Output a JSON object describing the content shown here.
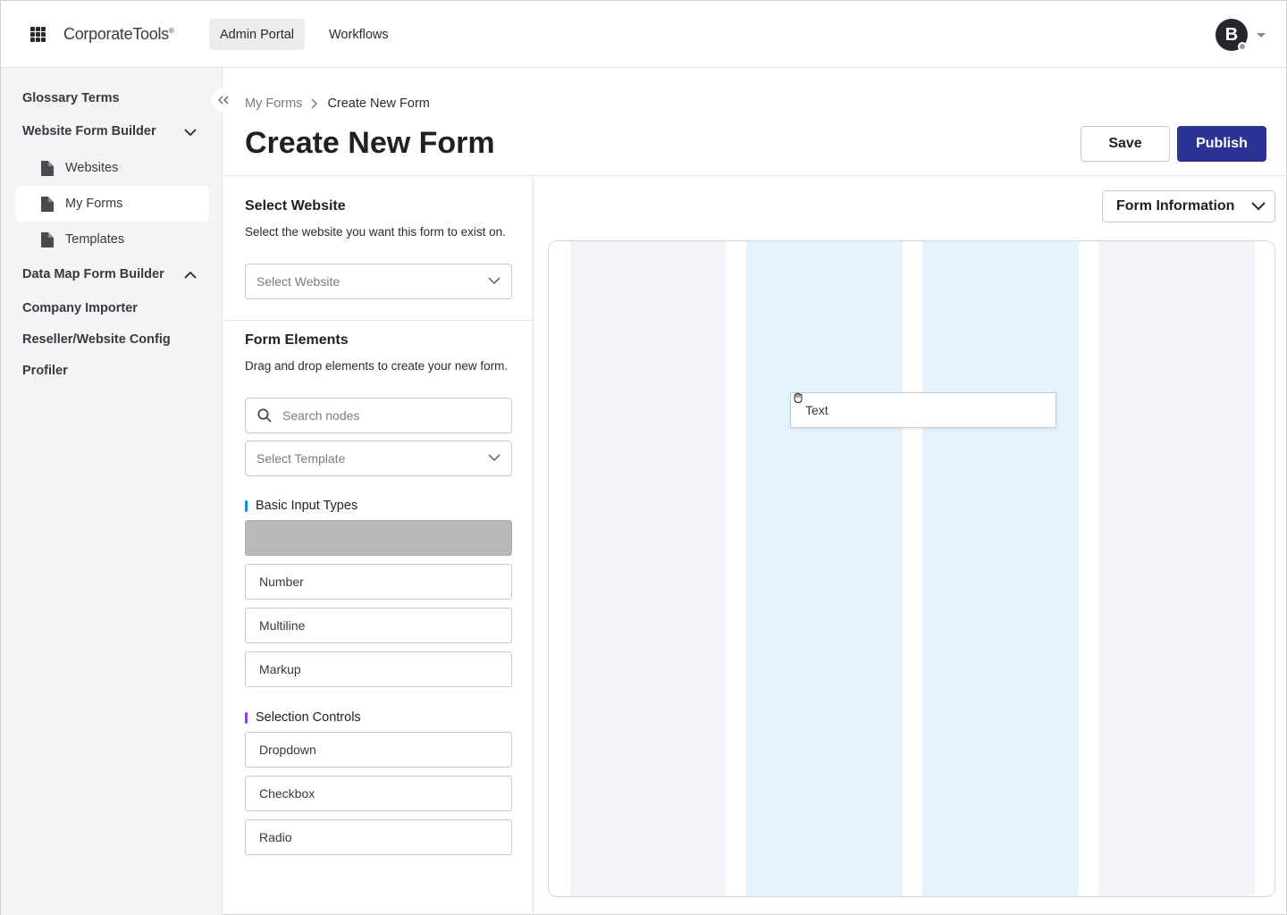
{
  "topbar": {
    "logo_text": "CorporateTools",
    "logo_mark": "®",
    "tabs": [
      {
        "label": "Admin Portal",
        "active": true
      },
      {
        "label": "Workflows",
        "active": false
      }
    ],
    "avatar_initial": "B"
  },
  "sidebar": {
    "items": [
      {
        "label": "Glossary Terms"
      },
      {
        "label": "Website Form Builder",
        "expanded": true
      },
      {
        "label": "Websites",
        "icon": "document-icon"
      },
      {
        "label": "My Forms",
        "icon": "document-icon",
        "active": true
      },
      {
        "label": "Templates",
        "icon": "document-icon"
      },
      {
        "label": "Data Map Form Builder",
        "expanded": false
      },
      {
        "label": "Company Importer"
      },
      {
        "label": "Reseller/Website Config"
      },
      {
        "label": "Profiler"
      }
    ]
  },
  "breadcrumb": {
    "parent": "My Forms",
    "current": "Create New Form"
  },
  "page": {
    "title": "Create New Form",
    "save_label": "Save",
    "publish_label": "Publish"
  },
  "select_website": {
    "title": "Select Website",
    "description": "Select the website you want this form to exist on.",
    "placeholder": "Select Website"
  },
  "form_elements": {
    "title": "Form Elements",
    "description": "Drag and drop elements to create your new form.",
    "search_placeholder": "Search nodes",
    "template_placeholder": "Select Template",
    "groups": [
      {
        "label": "Basic Input Types",
        "color": "#1e88e5",
        "items": [
          "",
          "Number",
          "Multiline",
          "Markup"
        ]
      },
      {
        "label": "Selection Controls",
        "color": "#8e44e0",
        "items": [
          "Dropdown",
          "Checkbox",
          "Radio"
        ]
      }
    ]
  },
  "canvas": {
    "form_info_label": "Form Information",
    "dragging_item": "Text"
  },
  "colors": {
    "primary": "#2c3394",
    "column_highlight": "#e3f2fd",
    "column_neutral": "#f4f4f8"
  }
}
